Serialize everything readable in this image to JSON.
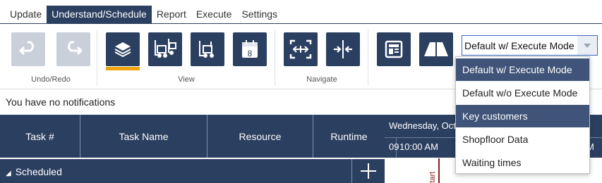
{
  "menu": {
    "tabs": [
      {
        "label": "Update"
      },
      {
        "label": "Understand/Schedule"
      },
      {
        "label": "Report"
      },
      {
        "label": "Execute"
      },
      {
        "label": "Settings"
      }
    ],
    "active_tab": "Understand/Schedule"
  },
  "ribbon": {
    "groups": {
      "undo_redo": "Undo/Redo",
      "view": "View",
      "navigate": "Navigate"
    },
    "calendar_day": "8",
    "view_combo_value": "Default w/ Execute Mode"
  },
  "notifications": {
    "text": "You have no notifications"
  },
  "grid": {
    "columns": [
      "Task #",
      "Task Name",
      "Resource",
      "Runtime"
    ],
    "group_label": "Scheduled"
  },
  "timeline": {
    "date_label": "Wednesday, Oct",
    "time_partial": "09",
    "time_label": "10:00 AM",
    "tail_label": "M",
    "vertical_marker": "Start"
  },
  "dropdown": {
    "options": [
      "Default w/ Execute Mode",
      "Default w/o Execute Mode",
      "Key customers",
      "Shopfloor Data",
      "Waiting times"
    ],
    "selected": "Default w/ Execute Mode",
    "hovered": "Key customers"
  },
  "colors": {
    "accent": "#2b3f60",
    "highlight": "#f0a30a",
    "disabled": "#c9d0d9"
  }
}
